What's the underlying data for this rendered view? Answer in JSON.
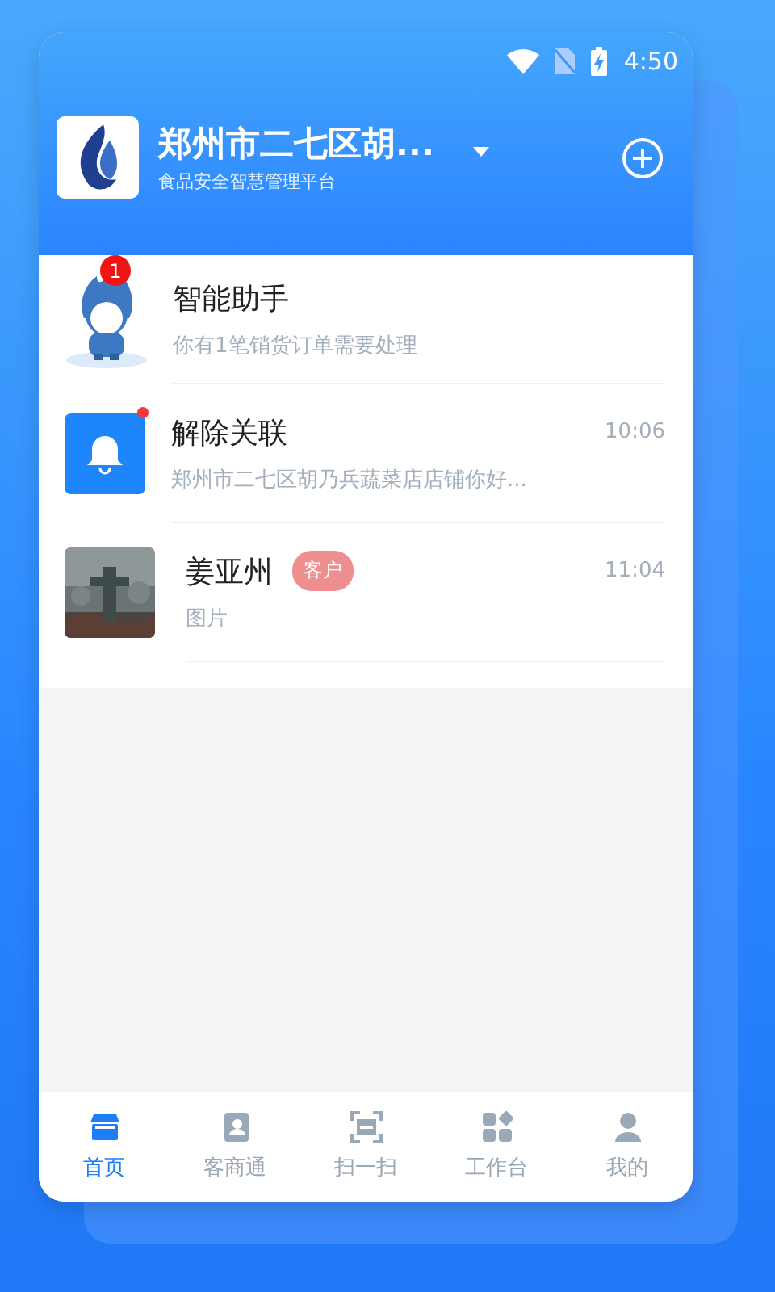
{
  "status_bar": {
    "time": "4:50"
  },
  "header": {
    "title": "郑州市二七区胡...",
    "subtitle": "食品安全智慧管理平台"
  },
  "messages": [
    {
      "kind": "assistant",
      "title": "智能助手",
      "preview": "你有1笔销货订单需要处理",
      "badge": "1"
    },
    {
      "kind": "notice",
      "title": "解除关联",
      "preview": "郑州市二七区胡乃兵蔬菜店店铺你好...",
      "time": "10:06",
      "unread": true
    },
    {
      "kind": "contact",
      "title": "姜亚州",
      "tag": "客户",
      "preview": "图片",
      "time": "11:04"
    }
  ],
  "tabs": [
    {
      "label": "首页",
      "kind": "store",
      "selected": true
    },
    {
      "label": "客商通",
      "kind": "contact",
      "selected": false
    },
    {
      "label": "扫一扫",
      "kind": "scan",
      "selected": false
    },
    {
      "label": "工作台",
      "kind": "grid",
      "selected": false
    },
    {
      "label": "我的",
      "kind": "user",
      "selected": false
    }
  ]
}
